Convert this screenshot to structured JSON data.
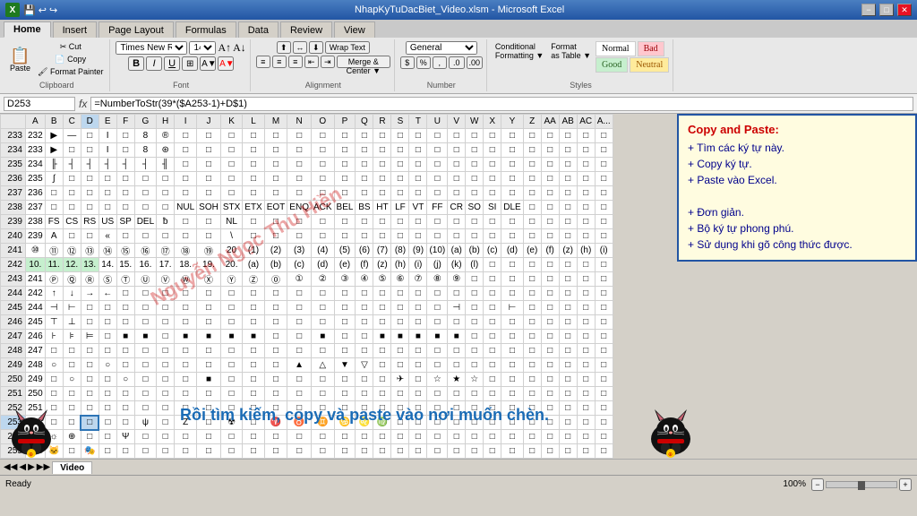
{
  "titlebar": {
    "title": "NhapKyTuDacBiet_Video.xlsm - Microsoft Excel",
    "icon": "X"
  },
  "ribbon": {
    "tabs": [
      "Home",
      "Insert",
      "Page Layout",
      "Formulas",
      "Data",
      "Review",
      "View"
    ],
    "active_tab": "Home",
    "groups": [
      "Clipboard",
      "Font",
      "Alignment",
      "Number",
      "Styles"
    ]
  },
  "formula_bar": {
    "cell_ref": "D253",
    "fx": "fx",
    "formula": "=NumberToStr(39*($A253-1)+D$1)"
  },
  "info_panel": {
    "title": "Copy and Paste:",
    "lines": [
      "+ Tìm các ký tự này.",
      "+ Copy ký tự.",
      "+ Paste vào Excel.",
      "",
      "+ Đơn giản.",
      "+ Bộ ký tự phong phú.",
      "+ Sử dụng khi gõ công thức được."
    ]
  },
  "bottom_banner": "Rồi tìm kiếm, copy và paste vào nơi muốn chèn.",
  "watermark": "Nguyễn Ngọc Thu Hiền",
  "sheet_tabs": [
    "Video"
  ],
  "active_sheet": "Video",
  "status": "Ready",
  "zoom": "100%",
  "col_headers": [
    "A",
    "B",
    "C",
    "D",
    "E",
    "F",
    "G",
    "H",
    "I",
    "J",
    "K",
    "L",
    "M",
    "N",
    "O",
    "P",
    "Q",
    "R",
    "S",
    "T",
    "U",
    "V",
    "W",
    "X",
    "Y",
    "Z",
    "AA",
    "AB",
    "AC",
    "A"
  ],
  "row_data": [
    {
      "row": 233,
      "cells": [
        "232",
        "▶",
        "—",
        "□",
        "I",
        "□",
        "8",
        "®",
        "□",
        "□",
        "□",
        "□",
        "□",
        "□",
        "□",
        "□",
        "□",
        "□",
        "□",
        "□",
        "□",
        "□",
        "□",
        "□",
        "□",
        "□",
        "□",
        "□",
        "□",
        "□"
      ]
    },
    {
      "row": 234,
      "cells": [
        "233",
        "▶",
        "□",
        "□",
        "I",
        "□",
        "8",
        "⊛",
        "□",
        "□",
        "□",
        "□",
        "□",
        "□",
        "□",
        "□",
        "□",
        "□",
        "□",
        "□",
        "□",
        "□",
        "□",
        "□",
        "□",
        "□",
        "□",
        "□",
        "□",
        "□"
      ]
    },
    {
      "row": 235,
      "cells": [
        "234",
        "╟",
        "┤",
        "┤",
        "┤",
        "┤",
        "┤",
        "╢",
        "□",
        "□",
        "□",
        "□",
        "□",
        "□",
        "□",
        "□",
        "□",
        "□",
        "□",
        "□",
        "□",
        "□",
        "□",
        "□",
        "□",
        "□",
        "□",
        "□",
        "□",
        "□"
      ]
    },
    {
      "row": 236,
      "cells": [
        "235",
        "∫",
        "□",
        "□",
        "□",
        "□",
        "□",
        "□",
        "□",
        "□",
        "□",
        "□",
        "□",
        "□",
        "□",
        "□",
        "□",
        "□",
        "□",
        "□",
        "□",
        "□",
        "□",
        "□",
        "□",
        "□",
        "□",
        "□",
        "□",
        "□"
      ]
    },
    {
      "row": 237,
      "cells": [
        "236",
        "□",
        "□",
        "□",
        "□",
        "□",
        "□",
        "□",
        "□",
        "□",
        "□",
        "□",
        "□",
        "□",
        "□",
        "□",
        "□",
        "□",
        "□",
        "□",
        "□",
        "□",
        "□",
        "□",
        "□",
        "□",
        "□",
        "□",
        "□",
        "□"
      ]
    },
    {
      "row": 238,
      "cells": [
        "237",
        "□",
        "□",
        "□",
        "□",
        "□",
        "□",
        "□",
        "NUL",
        "SOH",
        "STX",
        "ETX",
        "EOT",
        "ENQ",
        "ACK",
        "BEL",
        "BS",
        "HT",
        "LF",
        "VT",
        "FF",
        "CR",
        "SO",
        "SI",
        "DLE",
        "□",
        "□",
        "□",
        "□",
        "□"
      ]
    },
    {
      "row": 239,
      "cells": [
        "238",
        "FS",
        "CS",
        "RS",
        "US",
        "SP",
        "DEL",
        "ƀ",
        "□",
        "□",
        "NL",
        "□",
        "□",
        "□",
        "□",
        "□",
        "□",
        "□",
        "□",
        "□",
        "□",
        "□",
        "□",
        "□",
        "□",
        "□",
        "□",
        "□",
        "□",
        "□"
      ]
    },
    {
      "row": 240,
      "cells": [
        "239",
        "A",
        "□",
        "□",
        "«",
        "□",
        "□",
        "□",
        "□",
        "□",
        "\\",
        "□",
        "□",
        "□",
        "□",
        "□",
        "□",
        "□",
        "□",
        "□",
        "□",
        "□",
        "□",
        "□",
        "□",
        "□",
        "□",
        "□",
        "□",
        "□"
      ]
    },
    {
      "row": 241,
      "cells": [
        "⑩",
        "⑪",
        "⑫",
        "⑬",
        "⑭",
        "⑮",
        "⑯",
        "⑰",
        "⑱",
        "⑲",
        "20",
        "(1)",
        "(2)",
        "(3)",
        "(4)",
        "(5)",
        "(6)",
        "(7)",
        "(8)",
        "(9)",
        "(10)",
        "(a)",
        "(b)",
        "(c)",
        "(d)",
        "(e)",
        "(f)",
        "(z)",
        "(h)",
        "(i)"
      ]
    },
    {
      "row": 242,
      "cells": [
        "10.",
        "11.",
        "12.",
        "13.",
        "14.",
        "15.",
        "16.",
        "17.",
        "18.",
        "19.",
        "20.",
        "(a)",
        "(b)",
        "(c)",
        "(d)",
        "(e)",
        "(f)",
        "(z)",
        "(h)",
        "(i)",
        "(j)",
        "(k)",
        "(l)",
        "□",
        "□",
        "□",
        "□",
        "□",
        "□",
        "□"
      ]
    },
    {
      "row": 243,
      "cells": [
        "241",
        "Ⓟ",
        "Ⓠ",
        "Ⓡ",
        "Ⓢ",
        "Ⓣ",
        "Ⓤ",
        "Ⓥ",
        "Ⓦ",
        "Ⓧ",
        "Ⓨ",
        "Ⓩ",
        "⓪",
        "①",
        "②",
        "③",
        "④",
        "⑤",
        "⑥",
        "⑦",
        "⑧",
        "⑨",
        "□",
        "□",
        "□",
        "□",
        "□",
        "□",
        "□",
        "□"
      ]
    },
    {
      "row": 244,
      "cells": [
        "242",
        "↑",
        "↓",
        "→",
        "←",
        "□",
        "□",
        "□",
        "□",
        "□",
        "□",
        "□",
        "□",
        "□",
        "□",
        "□",
        "□",
        "□",
        "□",
        "□",
        "□",
        "□",
        "□",
        "□",
        "□",
        "□",
        "□",
        "□",
        "□",
        "□"
      ]
    },
    {
      "row": 245,
      "cells": [
        "244",
        "⊣",
        "⊢",
        "□",
        "□",
        "□",
        "□",
        "□",
        "□",
        "□",
        "□",
        "□",
        "□",
        "□",
        "□",
        "□",
        "□",
        "□",
        "□",
        "□",
        "□",
        "⊣",
        "□",
        "□",
        "⊢",
        "□",
        "□",
        "□",
        "□",
        "□"
      ]
    },
    {
      "row": 246,
      "cells": [
        "245",
        "⊤",
        "⊥",
        "□",
        "□",
        "□",
        "□",
        "□",
        "□",
        "□",
        "□",
        "□",
        "□",
        "□",
        "□",
        "□",
        "□",
        "□",
        "□",
        "□",
        "□",
        "□",
        "□",
        "□",
        "□",
        "□",
        "□",
        "□",
        "□",
        "□"
      ]
    },
    {
      "row": 247,
      "cells": [
        "246",
        "⊦",
        "⊧",
        "⊨",
        "□",
        "■",
        "■",
        "□",
        "■",
        "■",
        "■",
        "■",
        "□",
        "□",
        "■",
        "□",
        "□",
        "■",
        "■",
        "■",
        "■",
        "■",
        "□",
        "□",
        "□",
        "□",
        "□",
        "□",
        "□",
        "□"
      ]
    },
    {
      "row": 248,
      "cells": [
        "247",
        "□",
        "□",
        "□",
        "□",
        "□",
        "□",
        "□",
        "□",
        "□",
        "□",
        "□",
        "□",
        "□",
        "□",
        "□",
        "□",
        "□",
        "□",
        "□",
        "□",
        "□",
        "□",
        "□",
        "□",
        "□",
        "□",
        "□",
        "□",
        "□"
      ]
    },
    {
      "row": 249,
      "cells": [
        "248",
        "○",
        "□",
        "□",
        "○",
        "□",
        "□",
        "□",
        "□",
        "□",
        "□",
        "□",
        "□",
        "▲",
        "△",
        "▼",
        "▽",
        "□",
        "□",
        "□",
        "□",
        "□",
        "□",
        "□",
        "□",
        "□",
        "□",
        "□",
        "□",
        "□"
      ]
    },
    {
      "row": 250,
      "cells": [
        "249",
        "□",
        "○",
        "□",
        "□",
        "○",
        "□",
        "□",
        "□",
        "■",
        "□",
        "□",
        "□",
        "□",
        "□",
        "□",
        "□",
        "□",
        "✈",
        "□",
        "☆",
        "★",
        "☆",
        "□",
        "□",
        "□",
        "□",
        "□",
        "□",
        "□"
      ]
    },
    {
      "row": 251,
      "cells": [
        "250",
        "□",
        "□",
        "□",
        "□",
        "□",
        "□",
        "□",
        "□",
        "□",
        "□",
        "□",
        "□",
        "□",
        "□",
        "□",
        "□",
        "□",
        "□",
        "□",
        "□",
        "□",
        "□",
        "□",
        "□",
        "□",
        "□",
        "□",
        "□",
        "□"
      ]
    },
    {
      "row": 252,
      "cells": [
        "251",
        "□",
        "□",
        "□",
        "□",
        "□",
        "□",
        "□",
        "□",
        "□",
        "□",
        "□",
        "□",
        "□",
        "□",
        "□",
        "□",
        "□",
        "□",
        "□",
        "□",
        "□",
        "□",
        "□",
        "□",
        "□",
        "□",
        "□",
        "□",
        "□"
      ]
    },
    {
      "row": 253,
      "cells": [
        "252",
        "□",
        "□",
        "□",
        "□",
        "□",
        "ψ",
        "□",
        "Z",
        "□",
        "☢",
        "□",
        "♈",
        "♉",
        "♊",
        "♋",
        "♌",
        "♍",
        "□",
        "□",
        "□",
        "□",
        "□",
        "□",
        "□",
        "□",
        "□",
        "□",
        "□",
        "□"
      ]
    },
    {
      "row": 254,
      "cells": [
        "253",
        "☼",
        "⊕",
        "□",
        "□",
        "Ψ",
        "□",
        "□",
        "□",
        "□",
        "□",
        "□",
        "□",
        "□",
        "□",
        "□",
        "□",
        "□",
        "□",
        "□",
        "□",
        "□",
        "□",
        "□",
        "□",
        "□",
        "□",
        "□",
        "□",
        "□"
      ]
    },
    {
      "row": 255,
      "cells": [
        "254",
        "🐱",
        "□",
        "🎭",
        "□",
        "□",
        "□",
        "□",
        "□",
        "□",
        "□",
        "□",
        "□",
        "□",
        "□",
        "□",
        "□",
        "□",
        "□",
        "□",
        "□",
        "□",
        "□",
        "□",
        "□",
        "□",
        "□",
        "□",
        "□",
        "□"
      ]
    }
  ],
  "styles": {
    "normal": "Normal",
    "bad": "Bad",
    "good": "Good",
    "neutral": "Neutral"
  },
  "buttons": {
    "minimize": "−",
    "maximize": "□",
    "close": "✕"
  }
}
